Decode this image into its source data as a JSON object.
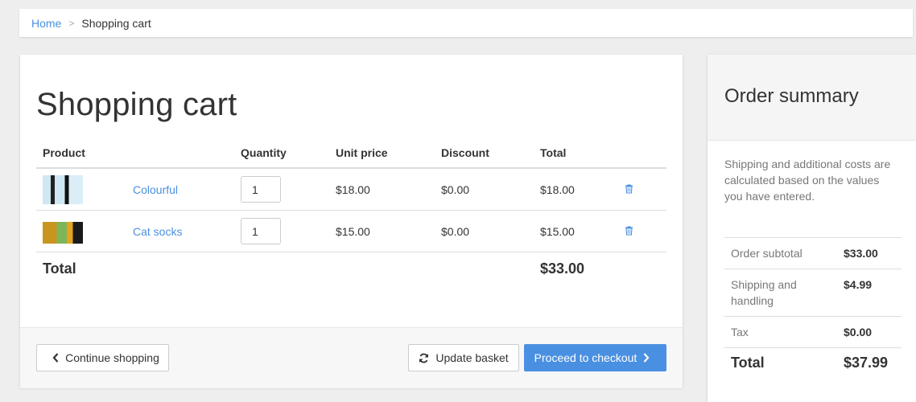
{
  "breadcrumb": {
    "home": "Home",
    "separator": ">",
    "current": "Shopping cart"
  },
  "cart": {
    "title": "Shopping cart",
    "headers": {
      "product": "Product",
      "quantity": "Quantity",
      "unit_price": "Unit price",
      "discount": "Discount",
      "total": "Total"
    },
    "items": [
      {
        "name": "Colourful",
        "quantity": "1",
        "unit_price": "$18.00",
        "discount": "$0.00",
        "total": "$18.00"
      },
      {
        "name": "Cat socks",
        "quantity": "1",
        "unit_price": "$15.00",
        "discount": "$0.00",
        "total": "$15.00"
      }
    ],
    "total_label": "Total",
    "total_value": "$33.00",
    "buttons": {
      "continue": "Continue shopping",
      "update": "Update basket",
      "checkout": "Proceed to checkout"
    }
  },
  "summary": {
    "title": "Order summary",
    "note": "Shipping and additional costs are calculated based on the values you have entered.",
    "rows": [
      {
        "label": "Order subtotal",
        "value": "$33.00"
      },
      {
        "label": "Shipping and handling",
        "value": "$4.99"
      },
      {
        "label": "Tax",
        "value": "$0.00"
      }
    ],
    "total_label": "Total",
    "total_value": "$37.99"
  },
  "colors": {
    "accent": "#4a90e2",
    "background": "#eeeeee"
  },
  "icons": [
    "chevron-left-icon",
    "refresh-icon",
    "chevron-right-icon",
    "trash-icon"
  ]
}
